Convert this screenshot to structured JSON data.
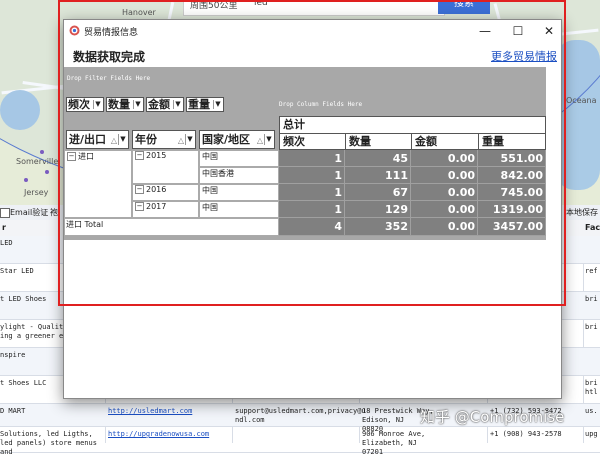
{
  "map": {
    "labels": [
      "Hanover",
      "Somerville",
      "Jersey",
      "Oceana"
    ],
    "search_select": "周围50公里",
    "search_value": "led",
    "search_button": "搜索"
  },
  "bg_table": {
    "toolbar": {
      "email_verify": "Email验证",
      "cut_text": "袍",
      "save": "本地保存"
    },
    "headers": [
      "r",
      "Fac"
    ],
    "rows": [
      {
        "name": "LED",
        "url": "",
        "email": "",
        "address": "",
        "phone": "",
        "extra": ""
      },
      {
        "name": "Star LED",
        "url": "",
        "email": "",
        "address": "",
        "phone": "",
        "extra": "ref"
      },
      {
        "name": "t LED Shoes",
        "url": "",
        "email": "",
        "address": "",
        "phone": "",
        "extra": "bri"
      },
      {
        "name": "ylight - Quality\ning a greener en",
        "url": "",
        "email": "",
        "address": "",
        "phone": "",
        "extra": "bri"
      },
      {
        "name": "nspire",
        "url": "",
        "email": "",
        "address": "",
        "phone": "",
        "extra": ""
      },
      {
        "name": "t Shoes LLC",
        "url": "",
        "email": "",
        "address": "",
        "phone": "",
        "extra": "bri\nhtl"
      },
      {
        "name": "D MART",
        "url": "http://usledmart.com",
        "email": "support@usledmart.com,privacy@u\nndl.com",
        "address": "18 Prestwick Way, Edison, NJ\n08820",
        "phone": "+1 (732) 593-8472",
        "extra": "us."
      },
      {
        "name": "Solutions, led Ligths,\nled panels) store menus and",
        "url": "http://upgradenowusa.com",
        "email": "",
        "address": "906 Monroe Ave, Elizabeth, NJ\n07201",
        "phone": "+1 (908) 943-2578",
        "extra": "upg"
      }
    ]
  },
  "dialog": {
    "title": "贸易情报信息",
    "status": "数据获取完成",
    "more_link": "更多贸易情报",
    "window_buttons": {
      "minimize": "—",
      "maximize": "☐",
      "close": "✕"
    },
    "pivot": {
      "filter_drop_text": "Drop Filter Fields Here",
      "column_drop_text": "Drop Column Fields Here",
      "data_fields": [
        "频次",
        "数量",
        "金额",
        "重量"
      ],
      "row_fields": [
        "进/出口",
        "年份",
        "国家/地区"
      ],
      "grand_total_label": "总计",
      "value_headers": [
        "频次",
        "数量",
        "金额",
        "重量"
      ],
      "direction": "进口",
      "years": [
        "2015",
        "2016",
        "2017"
      ],
      "rows": [
        {
          "country": "中国",
          "count": "1",
          "qty": "45",
          "amount": "0.00",
          "weight": "551.00"
        },
        {
          "country": "中国香港",
          "count": "1",
          "qty": "111",
          "amount": "0.00",
          "weight": "842.00"
        },
        {
          "country": "中国",
          "count": "1",
          "qty": "67",
          "amount": "0.00",
          "weight": "745.00"
        },
        {
          "country": "中国",
          "count": "1",
          "qty": "129",
          "amount": "0.00",
          "weight": "1319.00"
        }
      ],
      "total_label": "进口 Total",
      "total": {
        "count": "4",
        "qty": "352",
        "amount": "0.00",
        "weight": "3457.00"
      }
    }
  },
  "watermark": "知乎 @Compromise",
  "colors": {
    "highlight": "#e02020",
    "pivot_bg": "#a8a8a8",
    "value_bg": "#808080",
    "link": "#1a4ec2"
  }
}
